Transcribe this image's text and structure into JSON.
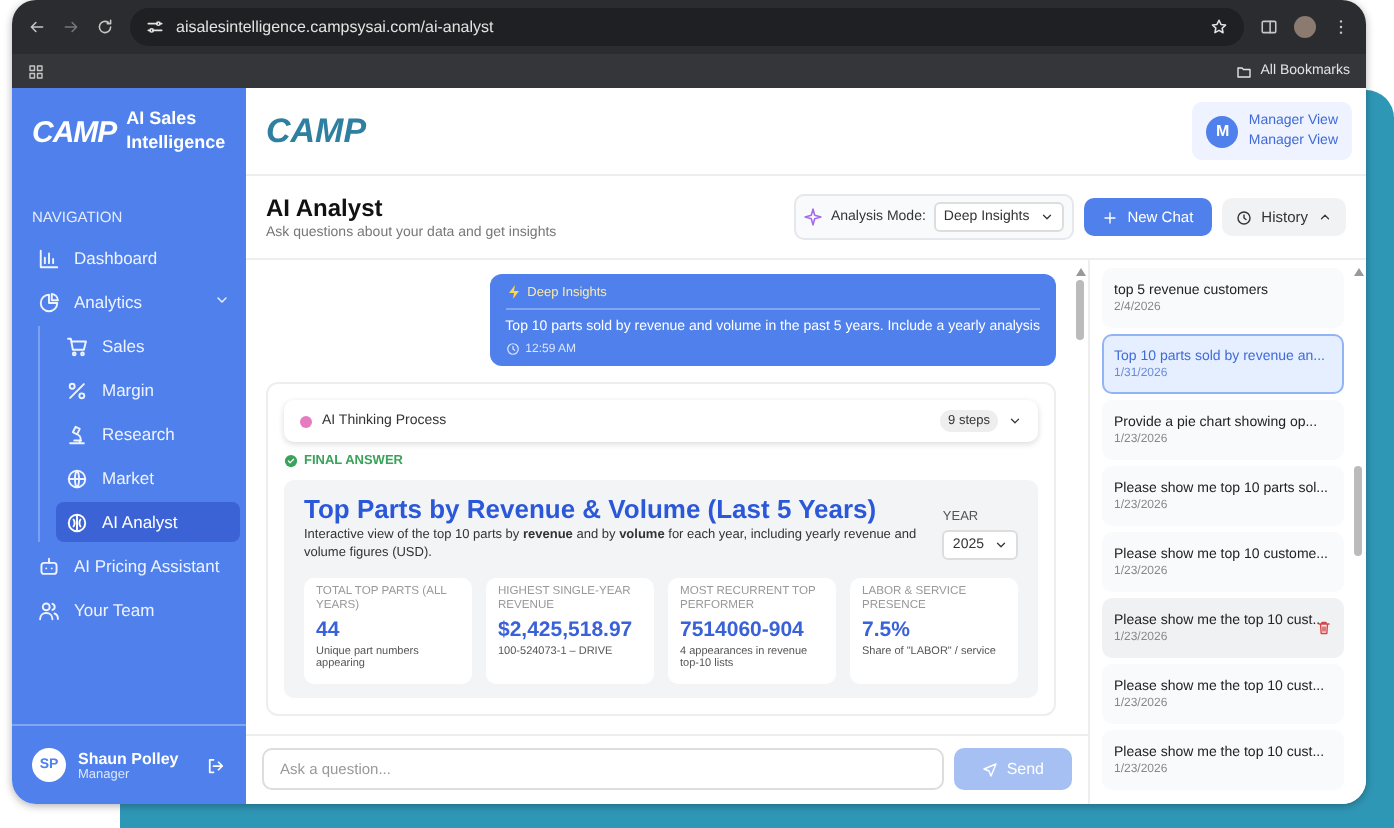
{
  "browser": {
    "url": "aisalesintelligence.campsysai.com/ai-analyst",
    "bookmarks": "All Bookmarks"
  },
  "sidebar": {
    "logo": "CAMP",
    "title": "AI Sales Intelligence",
    "nav_heading": "NAVIGATION",
    "items": [
      {
        "label": "Dashboard",
        "selected": false
      },
      {
        "label": "Analytics",
        "selected": false,
        "expanded": true,
        "children": [
          {
            "label": "Sales",
            "selected": false
          },
          {
            "label": "Margin",
            "selected": false
          },
          {
            "label": "Research",
            "selected": false
          },
          {
            "label": "Market",
            "selected": false
          },
          {
            "label": "AI Analyst",
            "selected": true
          }
        ]
      },
      {
        "label": "AI Pricing Assistant",
        "selected": false
      },
      {
        "label": "Your Team",
        "selected": false
      }
    ],
    "user": {
      "initials": "SP",
      "name": "Shaun Polley",
      "role": "Manager"
    }
  },
  "header": {
    "logo": "CAMP",
    "account": {
      "initial": "M",
      "title": "Manager View",
      "subtitle": "Manager View"
    }
  },
  "page": {
    "title": "AI Analyst",
    "subtitle": "Ask questions about your data and get insights",
    "analysis_mode_label": "Analysis Mode:",
    "analysis_mode": "Deep Insights",
    "new_chat": "New Chat",
    "history": "History",
    "history_expanded": true
  },
  "chat": {
    "user_message": {
      "mode": "Deep Insights",
      "text": "Top 10 parts sold by revenue and volume in the past 5 years. Include a yearly analysis",
      "time": "12:59 AM"
    },
    "answer": {
      "thinking_label": "AI Thinking Process",
      "steps": "9 steps",
      "thinking_expanded": false,
      "final_label": "FINAL ANSWER",
      "report": {
        "title": "Top Parts by Revenue & Volume (Last 5 Years)",
        "description": "Interactive view of the top 10 parts by **revenue** and by **volume** for each year, including yearly revenue and volume figures (USD).",
        "year_label": "YEAR",
        "year": "2025",
        "kpis": [
          {
            "label": "TOTAL TOP PARTS (ALL YEARS)",
            "value": "44",
            "note": "Unique part numbers appearing"
          },
          {
            "label": "HIGHEST SINGLE-YEAR REVENUE",
            "value": "$2,425,518.97",
            "note": "100-524073-1 – DRIVE"
          },
          {
            "label": "MOST RECURRENT TOP PERFORMER",
            "value": "7514060-904",
            "note": "4 appearances in revenue top-10 lists"
          },
          {
            "label": "LABOR & SERVICE PRESENCE",
            "value": "7.5%",
            "note": "Share of \"LABOR\" / service"
          }
        ]
      }
    }
  },
  "input": {
    "placeholder": "Ask a question...",
    "send": "Send",
    "send_disabled": true
  },
  "history": [
    {
      "title": "top 5 revenue customers",
      "date": "2/4/2026",
      "selected": false,
      "hovered": false
    },
    {
      "title": "Top 10 parts sold by revenue an...",
      "date": "1/31/2026",
      "selected": true,
      "hovered": false
    },
    {
      "title": "Provide a pie chart showing op...",
      "date": "1/23/2026",
      "selected": false,
      "hovered": false
    },
    {
      "title": "Please show me top 10 parts sol...",
      "date": "1/23/2026",
      "selected": false,
      "hovered": false
    },
    {
      "title": "Please show me top 10 custome...",
      "date": "1/23/2026",
      "selected": false,
      "hovered": false
    },
    {
      "title": "Please show me the top 10 cust...",
      "date": "1/23/2026",
      "selected": false,
      "hovered": true
    },
    {
      "title": "Please show me the top 10 cust...",
      "date": "1/23/2026",
      "selected": false,
      "hovered": false
    },
    {
      "title": "Please show me the top 10 cust...",
      "date": "1/23/2026",
      "selected": false,
      "hovered": false
    }
  ]
}
